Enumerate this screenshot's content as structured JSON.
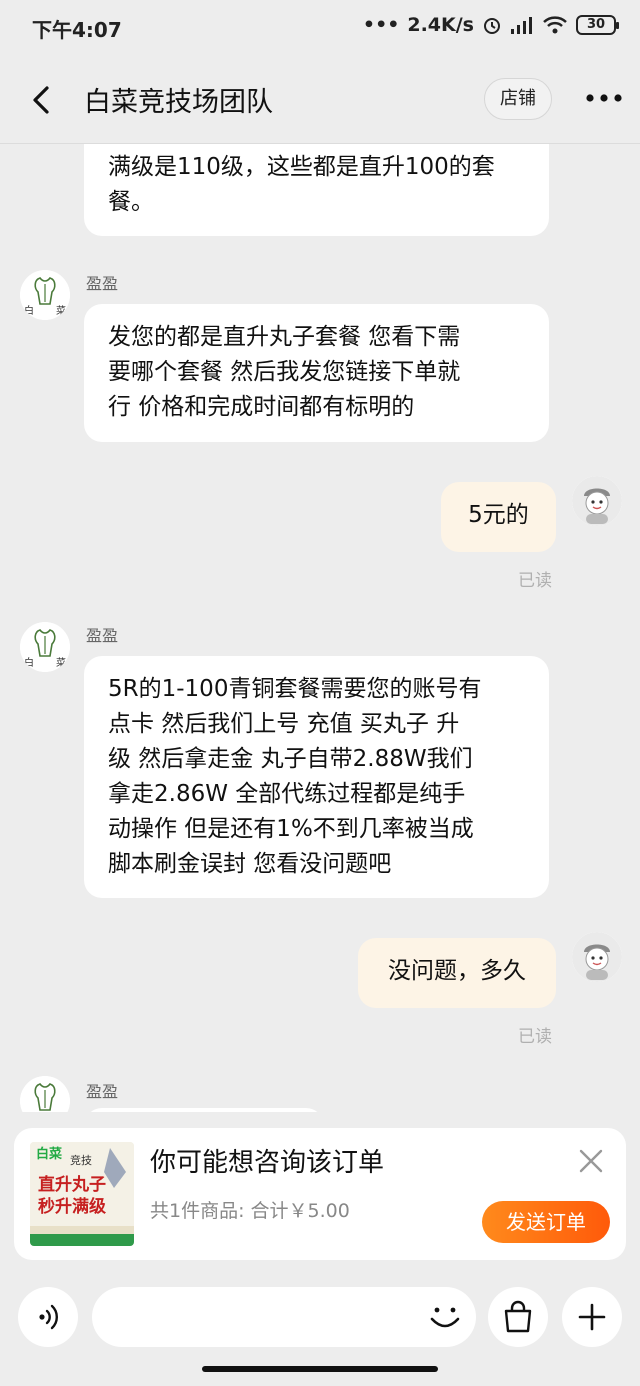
{
  "status_bar": {
    "time": "下午4:07",
    "network_speed": "2.4K/s",
    "battery": "30"
  },
  "header": {
    "back_icon": "chevron-left-icon",
    "title": "白菜竞技场团队",
    "shop_label": "店铺",
    "more_icon": "more-dots-icon"
  },
  "messages": [
    {
      "side": "other",
      "lines": [
        "满级是110级，这些都是直升100的套",
        "餐。"
      ]
    },
    {
      "side": "other",
      "sender": "盈盈",
      "lines": [
        "发您的都是直升丸子套餐 您看下需",
        "要哪个套餐 然后我发您链接下单就",
        "行 价格和完成时间都有标明的"
      ]
    },
    {
      "side": "me",
      "text": "5元的",
      "status": "已读"
    },
    {
      "side": "other",
      "sender": "盈盈",
      "lines": [
        "5R的1-100青铜套餐需要您的账号有",
        "点卡 然后我们上号 充值 买丸子 升",
        "级 然后拿走金 丸子自带2.88W我们",
        "拿走2.86W 全部代练过程都是纯手",
        "动操作 但是还有1%不到几率被当成",
        "脚本刷金误封  您看没问题吧"
      ]
    },
    {
      "side": "me",
      "text": "没问题，多久",
      "status": "已读"
    },
    {
      "side": "other",
      "sender": "盈盈"
    }
  ],
  "order_card": {
    "title": "你可能想咨询该订单",
    "summary": "共1件商品: 合计￥5.00",
    "send_label": "发送订单",
    "thumb_text": {
      "top": "白菜",
      "badge": "竞技",
      "line1": "直升丸子",
      "line2": "秒升满级"
    }
  },
  "input_bar": {
    "voice_icon": "voice-icon",
    "emoji_icon": "smile-icon",
    "bag_icon": "shopping-bag-icon",
    "plus_icon": "plus-icon",
    "placeholder": ""
  },
  "colors": {
    "background": "#ededed",
    "my_bubble": "#fdf4e6",
    "other_bubble": "#ffffff",
    "accent_orange": "#ff6a12"
  }
}
